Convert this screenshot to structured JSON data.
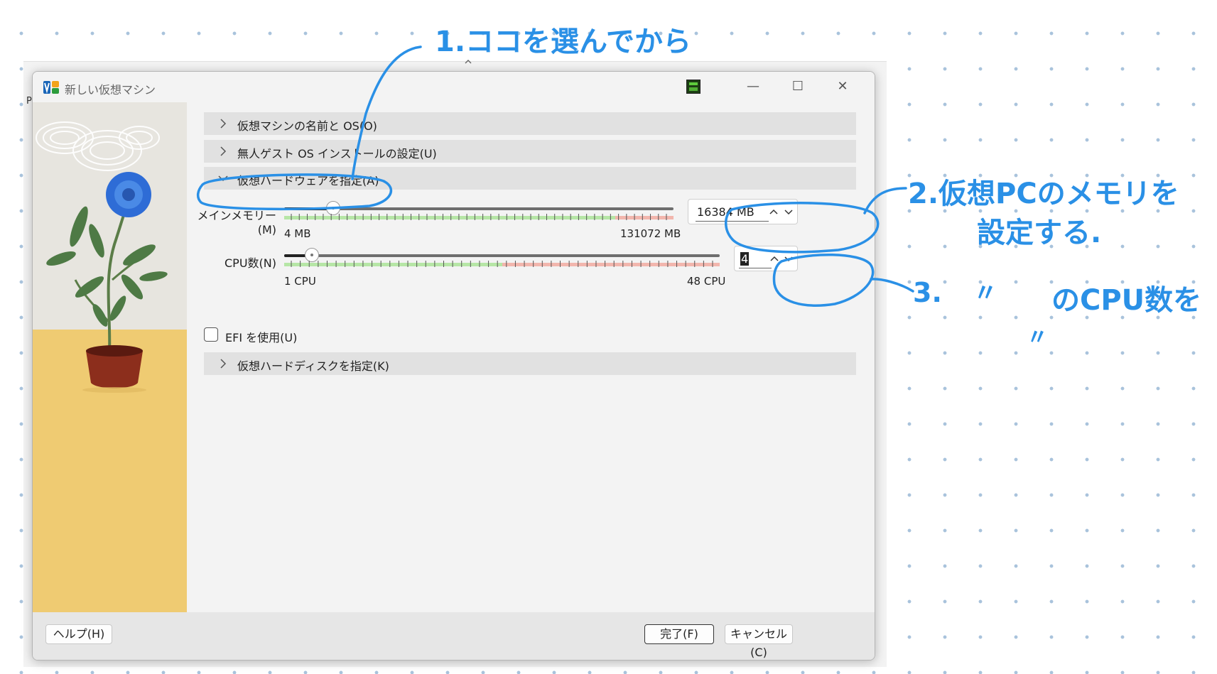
{
  "background_app": {
    "label": "P"
  },
  "window": {
    "title": "新しい仮想マシン",
    "controls": {
      "minimize": "—",
      "maximize": "☐",
      "close": "✕"
    }
  },
  "sections": {
    "name_os": "仮想マシンの名前と OS(O)",
    "unattended": "無人ゲスト OS インストールの設定(U)",
    "hardware": "仮想ハードウェアを指定(A)",
    "harddisk": "仮想ハードディスクを指定(K)"
  },
  "memory": {
    "label": "メインメモリー(M)",
    "value": "16384 MB",
    "min_label": "4 MB",
    "max_label": "131072 MB",
    "fraction": 0.125
  },
  "cpu": {
    "label": "CPU数(N)",
    "value": "4",
    "min_label": "1 CPU",
    "max_label": "48 CPU",
    "fraction": 0.064
  },
  "efi": {
    "label": "EFI を使用(U)",
    "checked": false
  },
  "footer": {
    "help": "ヘルプ(H)",
    "finish": "完了(F)",
    "cancel": "キャンセル(C)"
  },
  "annotations": {
    "step1": "1.ココを選んでから",
    "step2_line1": "2.仮想PCのメモリを",
    "step2_line2": "設定する.",
    "step3_ditto1": "〃",
    "step3_rest": "のCPU数を",
    "step3_ditto2": "〃",
    "step3_num": "3."
  },
  "colors": {
    "annotation": "#2a90e6",
    "tick_ok": "#b6e6a6",
    "tick_warn": "#f2b6ad"
  }
}
